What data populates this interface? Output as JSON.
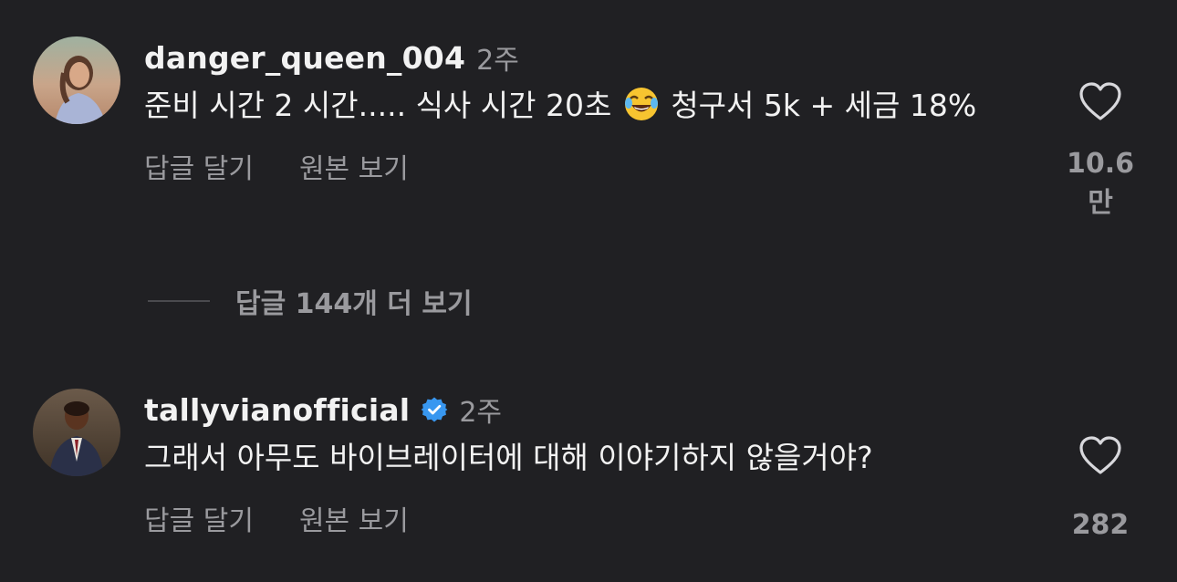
{
  "comments": [
    {
      "username": "danger_queen_004",
      "time": "2주",
      "verified": false,
      "text_before_emoji": "준비 시간 2 시간..... 식사 시간 20초 ",
      "emoji_icon": "face-with-tears-of-joy",
      "text_after_emoji": " 청구서 5k + 세금 18%",
      "likes": "10.6만",
      "reply_label": "답글 달기",
      "original_label": "원본 보기"
    },
    {
      "username": "tallyvianofficial",
      "time": "2주",
      "verified": true,
      "text": "그래서 아무도 바이브레이터에 대해 이야기하지 않을거야?",
      "likes": "282",
      "reply_label": "답글 달기",
      "original_label": "원본 보기"
    }
  ],
  "more_replies_label": "답글 144개 더 보기",
  "colors": {
    "background": "#202023",
    "text": "#f2f2f2",
    "muted": "#9a9a9e",
    "verified": "#3897f0"
  }
}
